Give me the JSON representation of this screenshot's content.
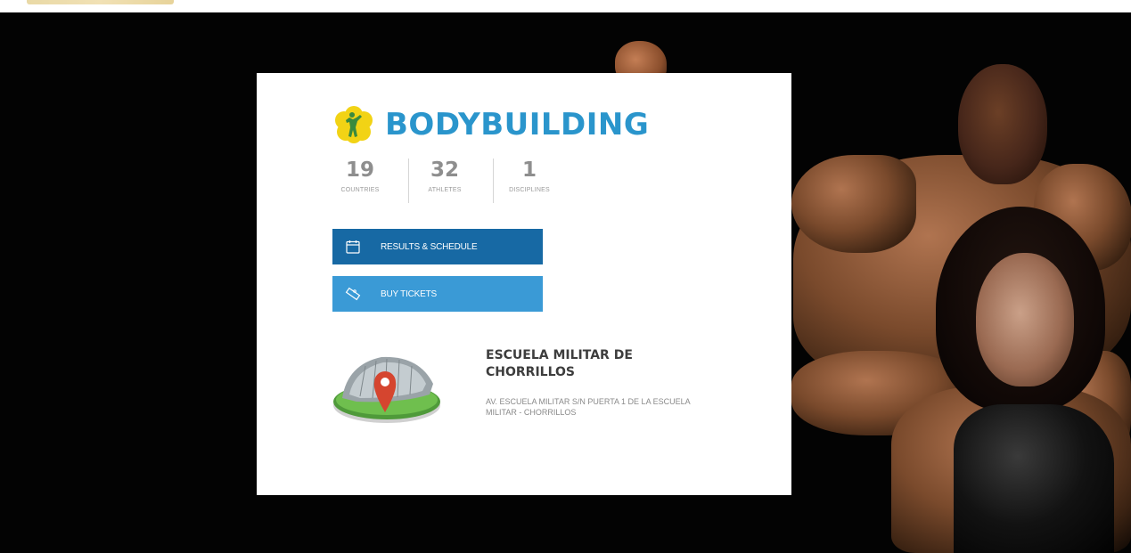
{
  "sport": {
    "title": "BODYBUILDING",
    "icon": "bodybuilder-icon",
    "accent_color": "#2a95cc",
    "icon_color": "#f2d315"
  },
  "stats": [
    {
      "value": "19",
      "label": "COUNTRIES"
    },
    {
      "value": "32",
      "label": "ATHLETES"
    },
    {
      "value": "1",
      "label": "DISCIPLINES"
    }
  ],
  "buttons": {
    "results": {
      "label": "RESULTS & SCHEDULE",
      "icon": "calendar-icon",
      "color": "#1769a4"
    },
    "tickets": {
      "label": "BUY TICKETS",
      "icon": "ticket-icon",
      "color": "#3a9ad6"
    }
  },
  "venue": {
    "name": "ESCUELA MILITAR DE CHORRILLOS",
    "address": "AV. ESCUELA MILITAR S/N PUERTA 1 DE LA ESCUELA MILITAR - CHORRILLOS",
    "icon": "venue-location-pin-icon"
  }
}
